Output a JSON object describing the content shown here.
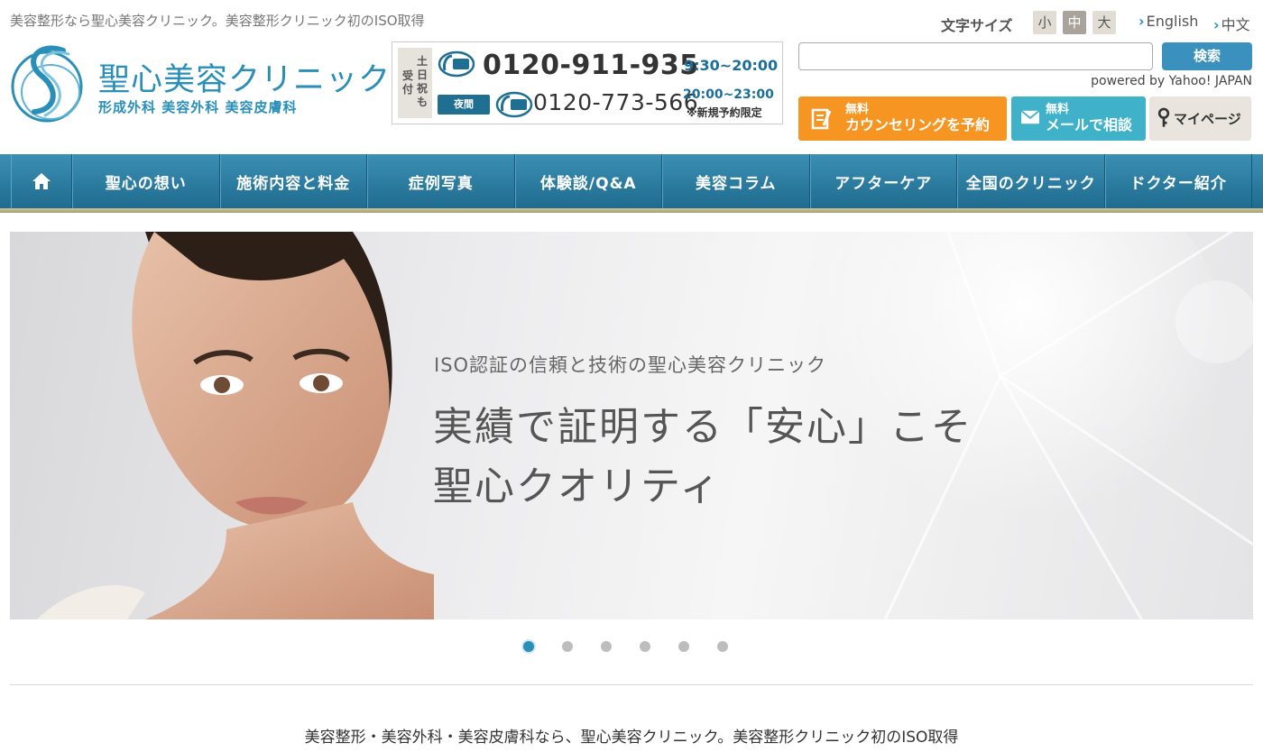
{
  "header": {
    "tagline": "美容整形なら聖心美容クリニック。美容整形クリニック初のISO取得",
    "logo": {
      "name": "聖心美容クリニック",
      "sub": "形成外科  美容外科  美容皮膚科"
    },
    "phone": {
      "weekend_col1": "受付",
      "weekend_col2": "土日祝も",
      "tel_main": "0120-911-935",
      "hours_main": "9:30~20:00",
      "night_label": "夜間",
      "tel_night": "0120-773-566",
      "hours_night": "20:00~23:00",
      "night_note": "※新規予約限定"
    },
    "font_size": {
      "label": "文字サイズ",
      "small": "小",
      "medium": "中",
      "large": "大"
    },
    "lang": {
      "english": "English",
      "chinese": "中文"
    },
    "search": {
      "value": "",
      "button": "検索",
      "powered": "powered by Yahoo! JAPAN"
    },
    "cta": {
      "counsel_small": "無料",
      "counsel_big": "カウンセリングを予約",
      "mail_small": "無料",
      "mail_big": "メールで相談",
      "mypage": "マイページ"
    }
  },
  "nav": {
    "items": [
      {
        "label": "聖心の想い"
      },
      {
        "label": "施術内容と料金"
      },
      {
        "label": "症例写真"
      },
      {
        "label": "体験談/Q&A"
      },
      {
        "label": "美容コラム"
      },
      {
        "label": "アフターケア"
      },
      {
        "label": "全国のクリニック"
      },
      {
        "label": "ドクター紹介"
      }
    ]
  },
  "hero": {
    "sub": "ISO認証の信頼と技術の聖心美容クリニック",
    "line1": "実績で証明する「安心」こそ",
    "line2": "聖心クオリティ",
    "slide_count": 6,
    "active_slide": 1
  },
  "footer_text": "美容整形・美容外科・美容皮膚科なら、聖心美容クリニック。美容整形クリニック初のISO取得",
  "colors": {
    "brand": "#2a8fb8",
    "nav": "#2a7ba0",
    "counsel": "#f79522",
    "mail": "#3fb2c9"
  }
}
